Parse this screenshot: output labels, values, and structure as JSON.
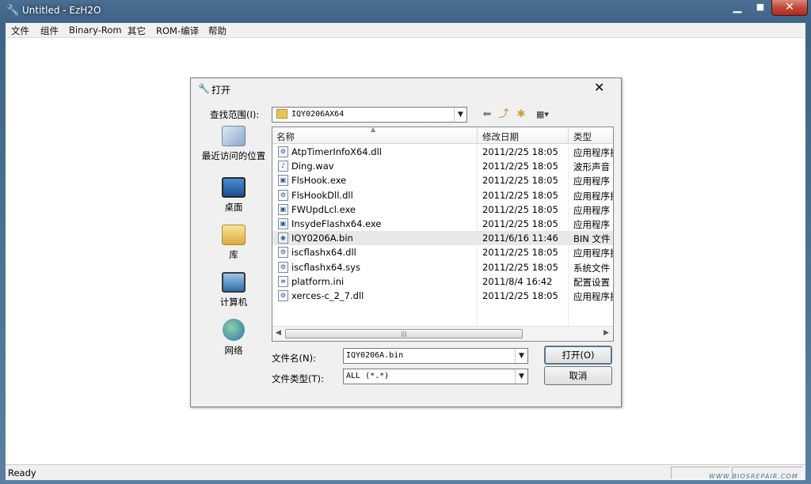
{
  "window": {
    "title": "Untitled - EzH2O",
    "min": "▁",
    "max": "■",
    "close": "✕"
  },
  "menu": [
    "文件",
    "组件",
    "Binary-Rom",
    "其它",
    "ROM-编译",
    "帮助"
  ],
  "status": {
    "text": "Ready"
  },
  "watermark": "WWW.BIOSREPAIR.COM",
  "dialog": {
    "title": "打开",
    "close": "✕",
    "lookin_label": "查找范围(I):",
    "lookin_value": "IQY0206AX64",
    "places": [
      {
        "label": "最近访问的位置",
        "icon": "recent-places-icon"
      },
      {
        "label": "桌面",
        "icon": "desktop-icon"
      },
      {
        "label": "库",
        "icon": "library-icon"
      },
      {
        "label": "计算机",
        "icon": "computer-icon"
      },
      {
        "label": "网络",
        "icon": "network-icon"
      }
    ],
    "columns": {
      "name": "名称",
      "date": "修改日期",
      "type": "类型"
    },
    "files": [
      {
        "name": "AtpTimerInfoX64.dll",
        "date": "2011/2/25 18:05",
        "type": "应用程序扩展",
        "icon": "dll-file-icon"
      },
      {
        "name": "Ding.wav",
        "date": "2011/2/25 18:05",
        "type": "波形声音",
        "icon": "audio-file-icon"
      },
      {
        "name": "FlsHook.exe",
        "date": "2011/2/25 18:05",
        "type": "应用程序",
        "icon": "exe-file-icon"
      },
      {
        "name": "FlsHookDll.dll",
        "date": "2011/2/25 18:05",
        "type": "应用程序扩展",
        "icon": "dll-file-icon"
      },
      {
        "name": "FWUpdLcl.exe",
        "date": "2011/2/25 18:05",
        "type": "应用程序",
        "icon": "exe-file-icon"
      },
      {
        "name": "InsydeFlashx64.exe",
        "date": "2011/2/25 18:05",
        "type": "应用程序",
        "icon": "exe-file-icon"
      },
      {
        "name": "IQY0206A.bin",
        "date": "2011/6/16 11:46",
        "type": "BIN 文件",
        "icon": "bin-file-icon"
      },
      {
        "name": "iscflashx64.dll",
        "date": "2011/2/25 18:05",
        "type": "应用程序扩展",
        "icon": "dll-file-icon"
      },
      {
        "name": "iscflashx64.sys",
        "date": "2011/2/25 18:05",
        "type": "系统文件",
        "icon": "sys-file-icon"
      },
      {
        "name": "platform.ini",
        "date": "2011/8/4 16:42",
        "type": "配置设置",
        "icon": "ini-file-icon"
      },
      {
        "name": "xerces-c_2_7.dll",
        "date": "2011/2/25 18:05",
        "type": "应用程序扩展",
        "icon": "dll-file-icon"
      }
    ],
    "selected_index": 6,
    "filename_label": "文件名(N):",
    "filename_value": "IQY0206A.bin",
    "filetype_label": "文件类型(T):",
    "filetype_value": "ALL (*.*)",
    "open_label": "打开(O)",
    "cancel_label": "取消"
  }
}
